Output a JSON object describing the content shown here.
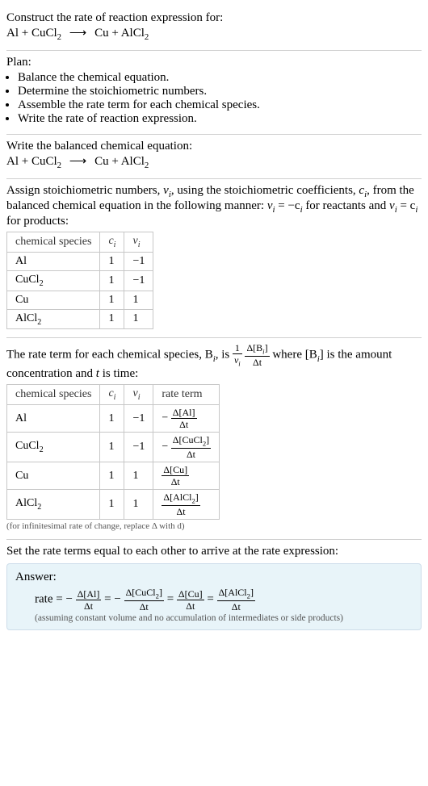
{
  "intro": {
    "prompt": "Construct the rate of reaction expression for:",
    "equation_lhs1": "Al + CuCl",
    "equation_sub1": "2",
    "arrow": "⟶",
    "equation_rhs1": "Cu + AlCl",
    "equation_sub2": "2"
  },
  "plan": {
    "title": "Plan:",
    "items": [
      "Balance the chemical equation.",
      "Determine the stoichiometric numbers.",
      "Assemble the rate term for each chemical species.",
      "Write the rate of reaction expression."
    ]
  },
  "balanced": {
    "title": "Write the balanced chemical equation:",
    "equation_lhs1": "Al + CuCl",
    "equation_sub1": "2",
    "arrow": "⟶",
    "equation_rhs1": "Cu + AlCl",
    "equation_sub2": "2"
  },
  "stoich": {
    "text1": "Assign stoichiometric numbers, ",
    "nu_i": "ν",
    "i_sub": "i",
    "text2": ", using the stoichiometric coefficients, ",
    "c_i": "c",
    "text3": ", from the balanced chemical equation in the following manner: ",
    "rel1a": "ν",
    "rel1b": " = −c",
    "rel1c": " for reactants and ",
    "rel2a": "ν",
    "rel2b": " = c",
    "rel2c": " for products:",
    "headers": {
      "species": "chemical species",
      "c": "c",
      "nu": "ν"
    },
    "rows": [
      {
        "species": "Al",
        "c": "1",
        "nu": "−1"
      },
      {
        "species": "CuCl",
        "species_sub": "2",
        "c": "1",
        "nu": "−1"
      },
      {
        "species": "Cu",
        "c": "1",
        "nu": "1"
      },
      {
        "species": "AlCl",
        "species_sub": "2",
        "c": "1",
        "nu": "1"
      }
    ]
  },
  "rateterm": {
    "text1": "The rate term for each chemical species, B",
    "text2": ", is ",
    "one": "1",
    "nu": "ν",
    "dB": "Δ[B",
    "dB2": "]",
    "dt": "Δt",
    "text3": " where [B",
    "text4": "] is the amount concentration and ",
    "t": "t",
    "text5": " is time:",
    "headers": {
      "species": "chemical species",
      "c": "c",
      "nu": "ν",
      "rate": "rate term"
    },
    "rows": [
      {
        "species": "Al",
        "c": "1",
        "nu": "−1",
        "neg": "−",
        "num": "Δ[Al]",
        "den": "Δt"
      },
      {
        "species": "CuCl",
        "species_sub": "2",
        "c": "1",
        "nu": "−1",
        "neg": "−",
        "num": "Δ[CuCl",
        "num_sub": "2",
        "num2": "]",
        "den": "Δt"
      },
      {
        "species": "Cu",
        "c": "1",
        "nu": "1",
        "neg": "",
        "num": "Δ[Cu]",
        "den": "Δt"
      },
      {
        "species": "AlCl",
        "species_sub": "2",
        "c": "1",
        "nu": "1",
        "neg": "",
        "num": "Δ[AlCl",
        "num_sub": "2",
        "num2": "]",
        "den": "Δt"
      }
    ],
    "footnote": "(for infinitesimal rate of change, replace Δ with d)"
  },
  "final": {
    "title": "Set the rate terms equal to each other to arrive at the rate expression:"
  },
  "answer": {
    "title": "Answer:",
    "rate_label": "rate = ",
    "eq": " = ",
    "terms": [
      {
        "neg": "−",
        "num": "Δ[Al]",
        "den": "Δt"
      },
      {
        "neg": "−",
        "num": "Δ[CuCl",
        "num_sub": "2",
        "num2": "]",
        "den": "Δt"
      },
      {
        "neg": "",
        "num": "Δ[Cu]",
        "den": "Δt"
      },
      {
        "neg": "",
        "num": "Δ[AlCl",
        "num_sub": "2",
        "num2": "]",
        "den": "Δt"
      }
    ],
    "note": "(assuming constant volume and no accumulation of intermediates or side products)"
  }
}
